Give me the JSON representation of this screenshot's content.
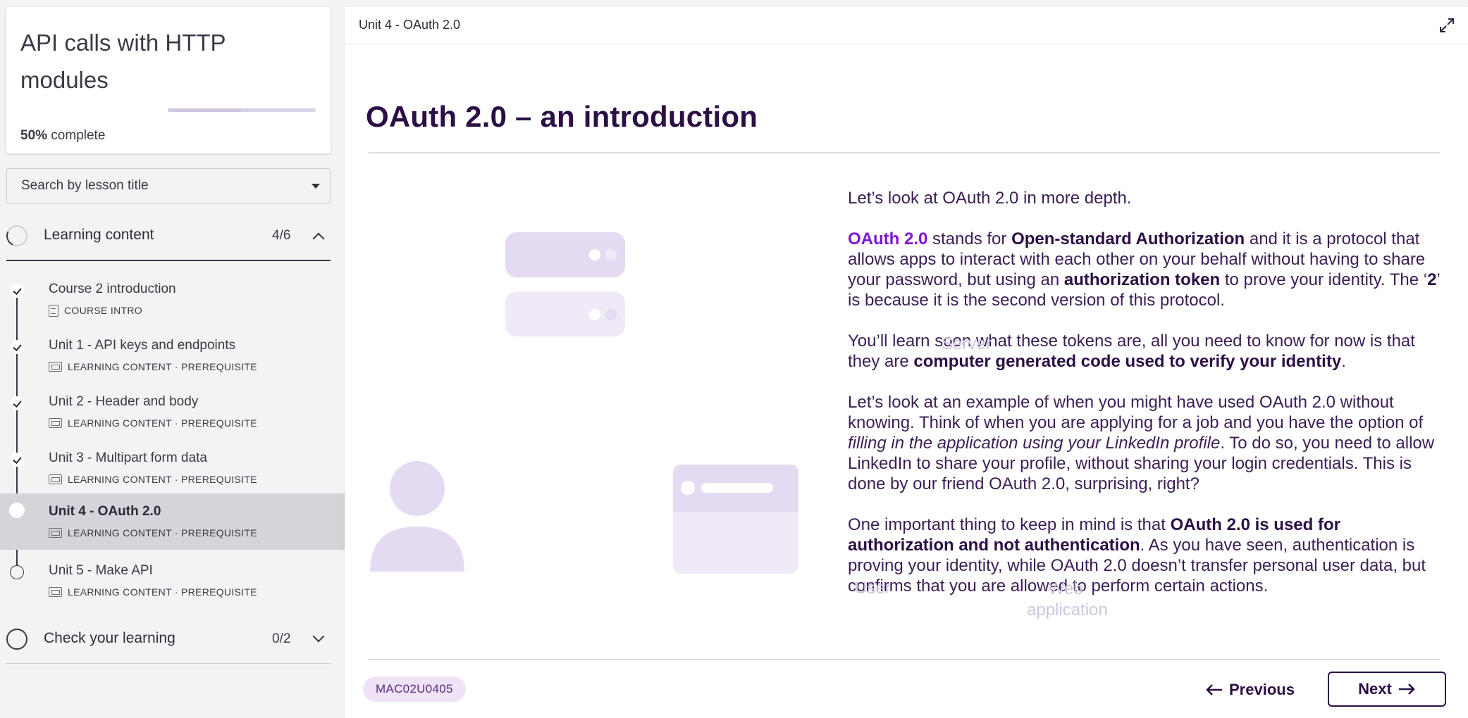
{
  "sidebar": {
    "course_title": "API calls with HTTP modules",
    "progress_percent": "50%",
    "progress_suffix": " complete",
    "progress_value": 0.5,
    "search_placeholder": "Search by lesson title",
    "sections": [
      {
        "label": "Learning content",
        "count": "4/6",
        "expanded": true,
        "lessons": [
          {
            "title": "Course 2 introduction",
            "meta": "COURSE INTRO",
            "icon": "document-icon",
            "status": "completed"
          },
          {
            "title": "Unit 1 - API keys and endpoints",
            "meta": "LEARNING CONTENT · PREREQUISITE",
            "icon": "screen-icon",
            "status": "completed"
          },
          {
            "title": "Unit 2 - Header and body",
            "meta": "LEARNING CONTENT · PREREQUISITE",
            "icon": "screen-icon",
            "status": "completed"
          },
          {
            "title": "Unit 3 - Multipart form data",
            "meta": "LEARNING CONTENT · PREREQUISITE",
            "icon": "screen-icon",
            "status": "completed"
          },
          {
            "title": "Unit 4 - OAuth 2.0",
            "meta": "LEARNING CONTENT · PREREQUISITE",
            "icon": "screen-icon",
            "status": "current"
          },
          {
            "title": "Unit 5 - Make API",
            "meta": "LEARNING CONTENT · PREREQUISITE",
            "icon": "screen-icon",
            "status": "not-started"
          }
        ]
      },
      {
        "label": "Check your learning",
        "count": "0/2",
        "expanded": false
      }
    ]
  },
  "main": {
    "breadcrumb": "Unit 4 - OAuth 2.0",
    "title": "OAuth 2.0 – an introduction",
    "illustration": {
      "server_label": "Server",
      "user_label": "User",
      "app_label": "Web application"
    },
    "paragraphs": {
      "p1": "Let’s look at OAuth 2.0 in more depth.",
      "p2_a": "OAuth 2.0",
      "p2_b": " stands for ",
      "p2_c": "Open-standard Authorization",
      "p2_d": " and it is a protocol that allows apps to interact with each other on your behalf without having to share your password, but using an ",
      "p2_e": "authorization token",
      "p2_f": " to prove your identity. The ‘",
      "p2_g": "2",
      "p2_h": "’ is because it is the second version of this protocol.",
      "p3_a": "You’ll learn soon what these tokens are, all you need to know for now is that they are ",
      "p3_b": "computer generated code used to verify your identity",
      "p3_c": ".",
      "p4_a": "Let’s look at an example of when you might have used OAuth 2.0 without knowing. Think of when you are applying for a job and you have the option of ",
      "p4_b": "filling in the application using your LinkedIn profile",
      "p4_c": ". To do so, you need to allow LinkedIn to share your profile, without sharing your login credentials. This is done by our friend OAuth 2.0, surprising, right?",
      "p5_a": "One important thing to keep in mind is that ",
      "p5_b": "OAuth 2.0 is used for authorization and not authentication",
      "p5_c": ". As you have seen, authentication is proving your identity, while OAuth 2.0 doesn’t transfer personal user data, but confirms that you are allowed to perform certain actions."
    },
    "lesson_code": "MAC02U0405",
    "prev_label": "Previous",
    "next_label": "Next"
  },
  "colors": {
    "accent": "#7d15d6",
    "heading": "#2b0f45",
    "illustration_light": "#e4daf1",
    "illustration_lighter": "#f0eaf8"
  }
}
